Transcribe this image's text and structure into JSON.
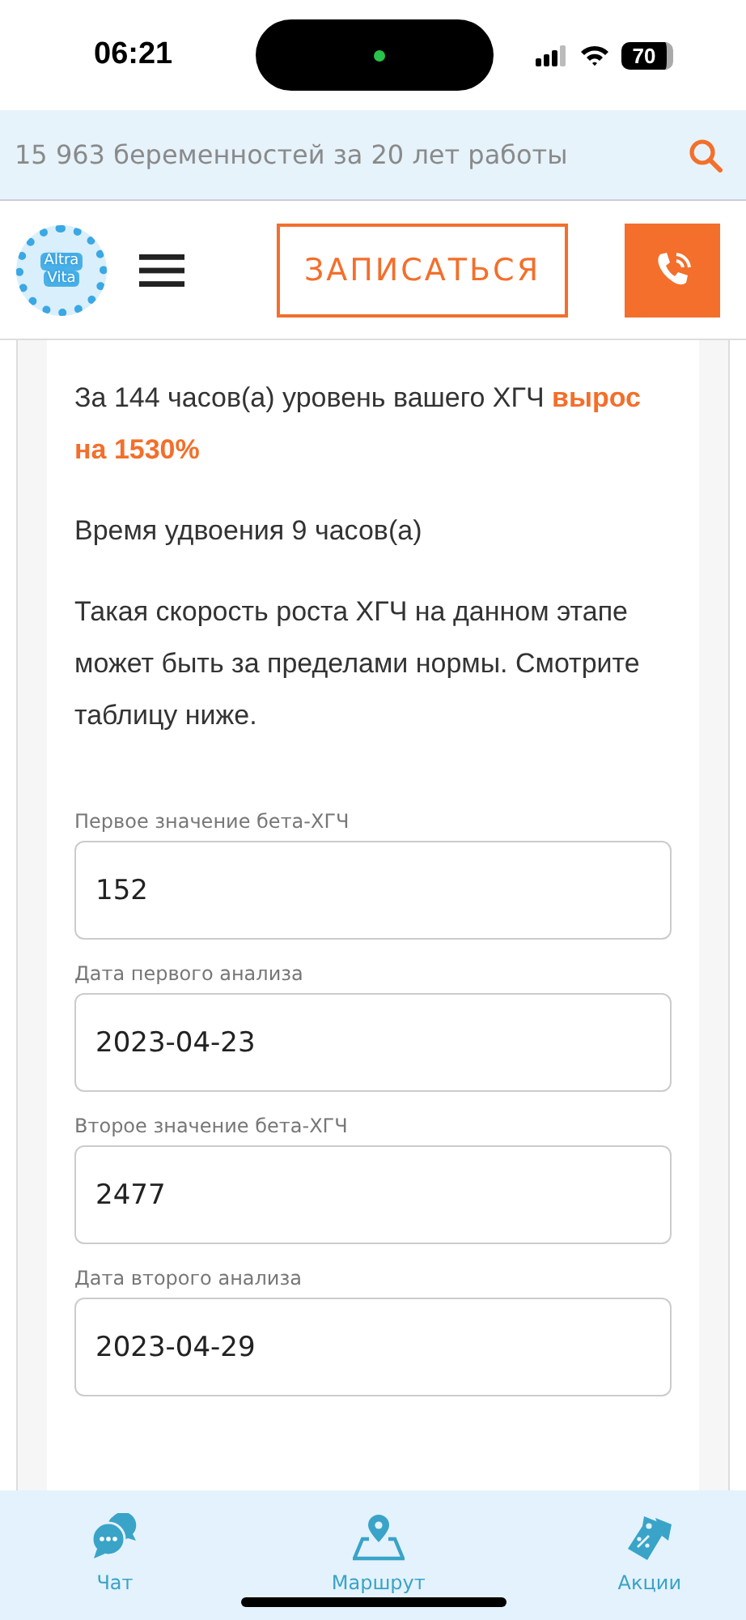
{
  "status_bar": {
    "time": "06:21",
    "battery": "70"
  },
  "promo_bar": {
    "text": "15 963 беременностей за 20 лет работы"
  },
  "header": {
    "logo_lines": [
      "Altra",
      "Vita"
    ],
    "signup_button": "ЗАПИСАТЬСЯ"
  },
  "result": {
    "paragraphs": [
      "За 144 часов(а) уровень вашего ХГЧ **вырос на 1530%**",
      "Время удвоения 9 часов(а)",
      "Такая скорость роста ХГЧ на данном этапе может быть за пределами нормы. Смотрите таблицу ниже."
    ]
  },
  "fields": [
    {
      "label": "Первое значение бета-ХГЧ",
      "value": "152"
    },
    {
      "label": "Дата первого анализа",
      "value": "2023-04-23"
    },
    {
      "label": "Второе значение бета-ХГЧ",
      "value": "2477"
    },
    {
      "label": "Дата второго анализа",
      "value": "2023-04-29"
    }
  ],
  "bottom_nav": [
    {
      "kind": "chat",
      "label": "Чат"
    },
    {
      "kind": "route",
      "label": "Маршрут"
    },
    {
      "kind": "offers",
      "label": "Акции"
    }
  ]
}
